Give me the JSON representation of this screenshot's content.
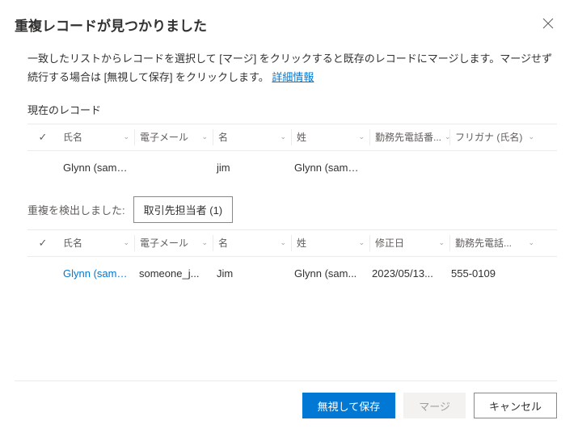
{
  "dialog": {
    "title": "重複レコードが見つかりました",
    "description_part1": "一致したリストからレコードを選択して [マージ] をクリックすると既存のレコードにマージします。マージせず続行する場合は [無視して保存] をクリックします。",
    "more_info": "詳細情報"
  },
  "current_record": {
    "label": "現在のレコード",
    "columns": {
      "name": "氏名",
      "email": "電子メール",
      "first": "名",
      "last": "姓",
      "phone": "勤務先電話番...",
      "furigana": "フリガナ (氏名)"
    },
    "row": {
      "name": "Glynn (samp...",
      "email": "",
      "first": "jim",
      "last": "Glynn (samp...",
      "phone": "",
      "furigana": ""
    }
  },
  "duplicates": {
    "label": "重複を検出しました:",
    "tab": "取引先担当者 (1)",
    "columns": {
      "name": "氏名",
      "email": "電子メール",
      "first": "名",
      "last": "姓",
      "modified": "修正日",
      "phone": "勤務先電話..."
    },
    "row": {
      "name": "Glynn (sample) J",
      "email": "someone_j...",
      "first": "Jim",
      "last": "Glynn (sam...",
      "modified": "2023/05/13...",
      "phone": "555-0109"
    }
  },
  "footer": {
    "ignore_save": "無視して保存",
    "merge": "マージ",
    "cancel": "キャンセル"
  },
  "icons": {
    "close": "✕",
    "check": "✓",
    "chevron": "╲╱"
  }
}
